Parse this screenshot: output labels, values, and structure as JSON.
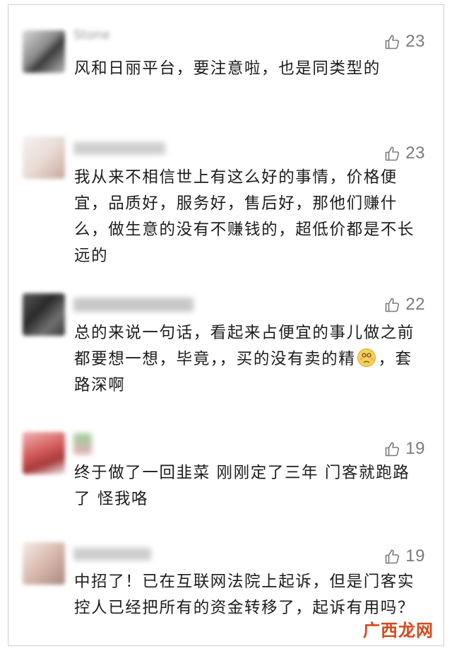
{
  "colors": {
    "text": "#1c1c1c",
    "like": "#7a7a7a",
    "border": "#cfcfcf",
    "watermark": "#d44a1b"
  },
  "icons": {
    "like": "thumbs-up-icon",
    "emoji": "dizzy-face-emoji"
  },
  "comments": [
    {
      "nickname": "Stone",
      "likes": "23",
      "text": "风和日丽平台，要注意啦，也是同类型的"
    },
    {
      "nickname": "",
      "likes": "23",
      "text": "我从来不相信世上有这么好的事情，价格便宜，品质好，服务好，售后好，那他们赚什么，做生意的没有不赚钱的，超低价都是不长远的"
    },
    {
      "nickname": "",
      "likes": "22",
      "text_before_emoji": "总的来说一句话，看起来占便宜的事儿做之前都要想一想，毕竟，，买的没有卖的精",
      "text_after_emoji": "，套路深啊"
    },
    {
      "nickname": "",
      "likes": "19",
      "text": "终于做了一回韭菜 刚刚定了三年 门客就跑路了 怪我咯"
    },
    {
      "nickname": "",
      "likes": "19",
      "text": "中招了！已在互联网法院上起诉，但是门客实控人已经把所有的资金转移了，起诉有用吗？"
    }
  ],
  "watermark": "广西龙网"
}
